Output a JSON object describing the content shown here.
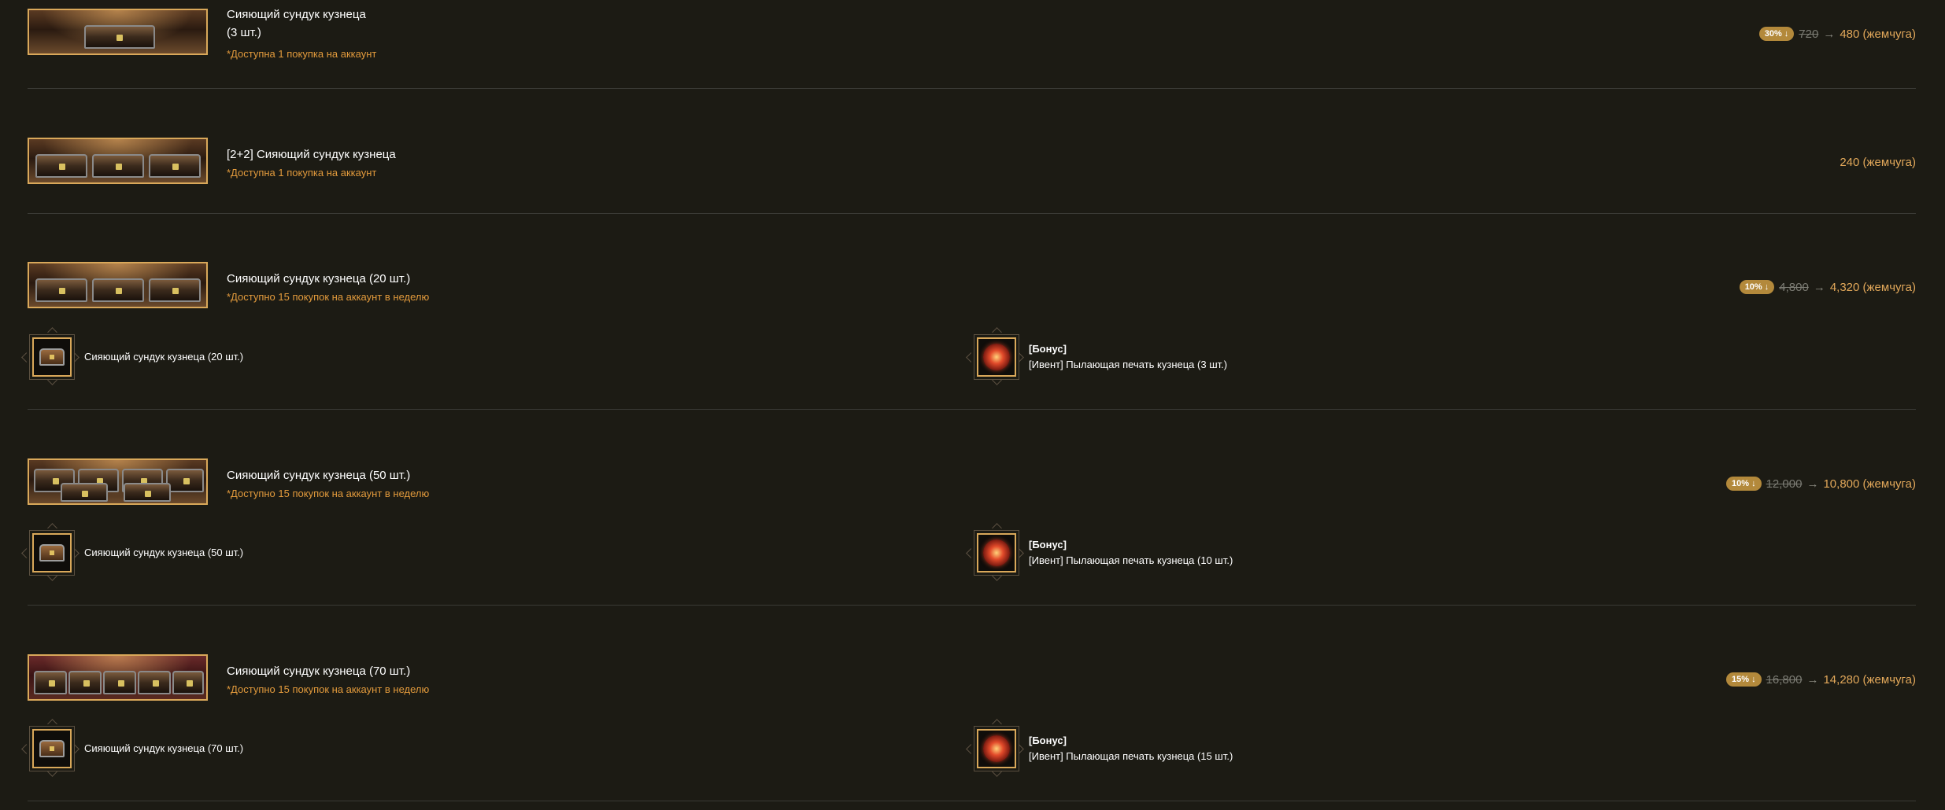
{
  "products": [
    {
      "name_lines": [
        "Сияющий сундук кузнеца",
        "(3 шт.)"
      ],
      "limit": "*Доступна 1 покупка на аккаунт",
      "discount": "30% ↓",
      "old_price": "720",
      "arrow": "→",
      "price": "480 (жемчуга)",
      "chest_count": 1
    },
    {
      "name_lines": [
        "[2+2] Сияющий сундук кузнеца"
      ],
      "limit": "*Доступна 1 покупка на аккаунт",
      "price": "240 (жемчуга)",
      "chest_count": 3
    },
    {
      "name_lines": [
        "Сияющий сундук кузнеца (20 шт.)"
      ],
      "limit": "*Доступно 15 покупок на аккаунт в неделю",
      "discount": "10% ↓",
      "old_price": "4,800",
      "arrow": "→",
      "price": "4,320 (жемчуга)",
      "chest_count": 3,
      "contents": {
        "item_label": "Сияющий сундук кузнеца (20 шт.)",
        "bonus_title": "[Бонус]",
        "bonus_label": "[Ивент] Пылающая печать кузнеца (3 шт.)"
      }
    },
    {
      "name_lines": [
        "Сияющий сундук кузнеца (50 шт.)"
      ],
      "limit": "*Доступно 15 покупок на аккаунт в неделю",
      "discount": "10% ↓",
      "old_price": "12,000",
      "arrow": "→",
      "price": "10,800 (жемчуга)",
      "chest_count": 5,
      "contents": {
        "item_label": "Сияющий сундук кузнеца (50 шт.)",
        "bonus_title": "[Бонус]",
        "bonus_label": "[Ивент] Пылающая печать кузнеца (10 шт.)"
      }
    },
    {
      "name_lines": [
        "Сияющий сундук кузнеца (70 шт.)"
      ],
      "limit": "*Доступно 15 покупок на аккаунт в неделю",
      "discount": "15% ↓",
      "old_price": "16,800",
      "arrow": "→",
      "price": "14,280 (жемчуга)",
      "chest_count": 5,
      "contents": {
        "item_label": "Сияющий сундук кузнеца (70 шт.)",
        "bonus_title": "[Бонус]",
        "bonus_label": "[Ивент] Пылающая печать кузнеца (15 шт.)"
      }
    }
  ],
  "icons": {
    "item": "chest-icon",
    "bonus": "blazing-seal-icon"
  },
  "colors": {
    "background": "#1c1b14",
    "accent": "#e2a85a",
    "limit_text": "#e29a3c",
    "badge": "#b3893b",
    "frame": "#d9a85a"
  }
}
